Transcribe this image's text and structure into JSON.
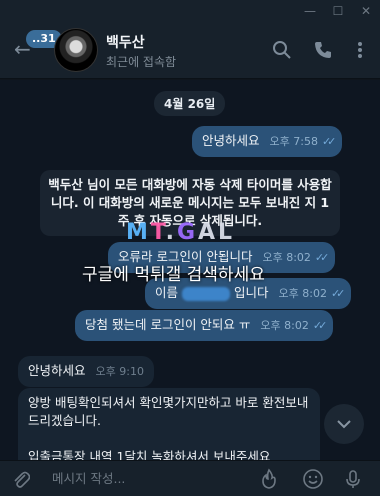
{
  "header": {
    "unread_count": "..31",
    "name": "백두산",
    "status": "최근에 접속함"
  },
  "chat": {
    "date": "4월 26일",
    "service_message": "백두산 님이 모든 대화방에 자동 삭제 타이머를 사용합니다. 이 대화방의 새로운 메시지는 모두 보내진 지 1주 후 자동으로 삭제됩니다.",
    "watermark": "MT.GAL",
    "watermark_sub": "구글에 먹튀갤 검색하세요",
    "messages": [
      {
        "dir": "out",
        "text": "안녕하세요",
        "time": "오후 7:58"
      },
      {
        "dir": "out",
        "text": "오류라 로그인이 안됩니다",
        "time": "오후 8:02"
      },
      {
        "dir": "out",
        "text_before": "이름",
        "text_after": "입니다",
        "time": "오후 8:02"
      },
      {
        "dir": "out",
        "text": "당첨 됐는데 로그인이 안되요 ㅠ",
        "time": "오후 8:02"
      },
      {
        "dir": "in",
        "text": "안녕하세요",
        "time": "오후 9:10"
      },
      {
        "dir": "in",
        "text": "양방 배팅확인되셔서 확인몇가지만하고 바로 환전보내드리겠습니다.",
        "time": ""
      },
      {
        "dir": "in",
        "text": "입출금통장 내역 1달치 녹화하셔서 보내주세요",
        "time": ""
      }
    ]
  },
  "composer": {
    "placeholder": "메시지 작성..."
  },
  "icons": {
    "search": "search-icon",
    "call": "phone-icon",
    "more": "more-vertical-icon",
    "attach": "paperclip-icon",
    "emoji": "emoji-icon",
    "mic": "microphone-icon",
    "fire": "fire-icon"
  }
}
